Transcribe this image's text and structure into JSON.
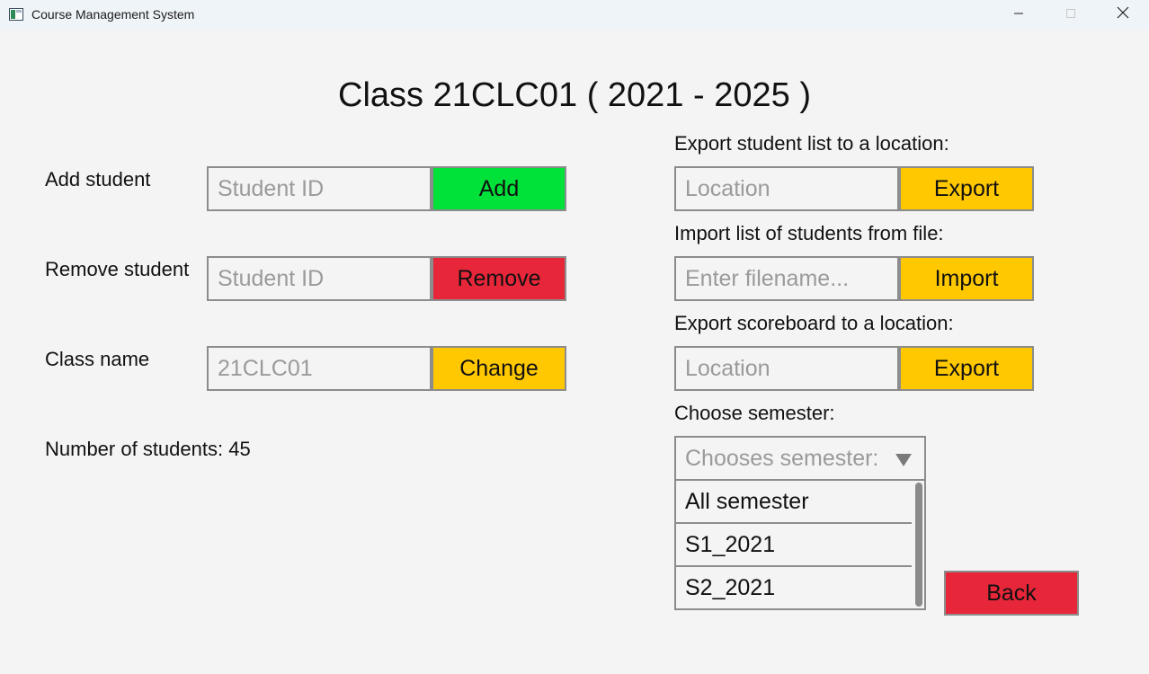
{
  "window": {
    "title": "Course Management System"
  },
  "heading": "Class 21CLC01 ( 2021 - 2025 )",
  "left_panel": {
    "add_student": {
      "label": "Add student",
      "placeholder": "Student ID",
      "button_label": "Add"
    },
    "remove_student": {
      "label": "Remove student",
      "placeholder": "Student ID",
      "button_label": "Remove"
    },
    "class_name": {
      "label": "Class name",
      "value": "21CLC01",
      "button_label": "Change"
    },
    "student_count_text": "Number of students: 45"
  },
  "right_panel": {
    "export_list": {
      "label": "Export student list to a location:",
      "placeholder": "Location",
      "button_label": "Export"
    },
    "import_list": {
      "label": "Import list of students from file:",
      "placeholder": "Enter filename...",
      "button_label": "Import"
    },
    "export_scoreboard": {
      "label": "Export scoreboard to a location:",
      "placeholder": "Location",
      "button_label": "Export"
    },
    "semester": {
      "label": "Choose semester:",
      "placeholder": "Chooses semester:",
      "options": [
        "All semester",
        "S1_2021",
        "S2_2021"
      ]
    }
  },
  "back_button_label": "Back",
  "colors": {
    "green_button": "#00e13a",
    "red_button": "#e8263a",
    "yellow_button": "#ffc800"
  },
  "icons": {
    "app": "window-app-icon",
    "minimize": "minimize-icon",
    "maximize": "maximize-icon",
    "close": "close-icon",
    "dropdown": "triangle-down-icon"
  }
}
